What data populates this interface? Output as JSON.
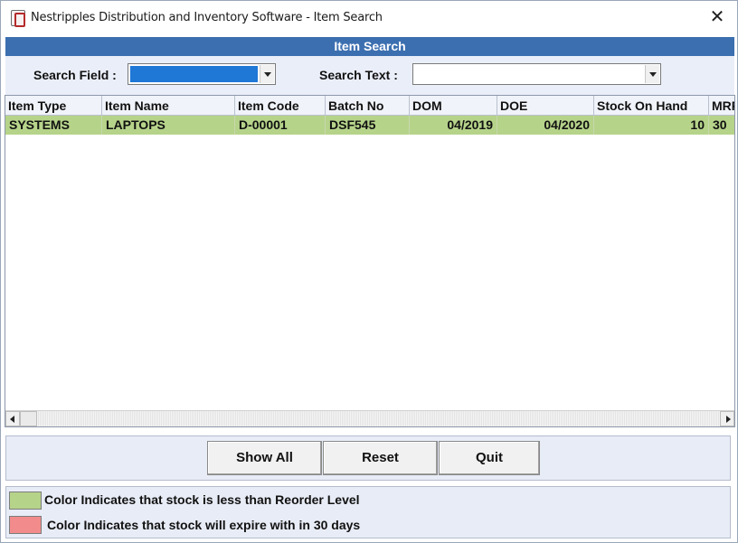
{
  "window": {
    "title": "Nestripples Distribution and Inventory Software - Item Search",
    "close_glyph": "✕"
  },
  "form": {
    "header": "Item Search"
  },
  "search": {
    "field_label": "Search Field :",
    "field_value": "",
    "text_label": "Search Text :",
    "text_value": ""
  },
  "grid": {
    "columns": [
      "Item Type",
      "Item Name",
      "Item Code",
      "Batch No",
      "DOM",
      "DOE",
      "Stock On Hand",
      "MRP"
    ],
    "rows": [
      {
        "item_type": "SYSTEMS",
        "item_name": "LAPTOPS",
        "item_code": "D-00001",
        "batch_no": "DSF545",
        "dom": "04/2019",
        "doe": "04/2020",
        "stock_on_hand": "10",
        "mrp": "30",
        "row_color": "#b6d38a"
      }
    ]
  },
  "buttons": {
    "show_all": "Show All",
    "reset": "Reset",
    "quit": "Quit"
  },
  "legend": {
    "items": [
      {
        "color": "#b6d38a",
        "text": "Color Indicates that stock is less than Reorder Level"
      },
      {
        "color": "#f28b8b",
        "text": "Color Indicates that stock will expire with in 30 days"
      }
    ]
  },
  "colors": {
    "header_bar": "#3c6fb0",
    "selected_field": "#1f77d6",
    "panel": "#e8ecf6"
  }
}
